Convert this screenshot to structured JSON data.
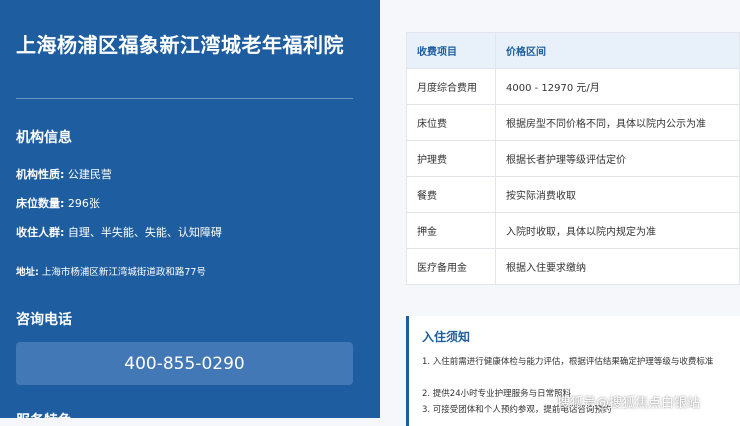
{
  "sidebar": {
    "title": "上海杨浦区福象新江湾城老年福利院",
    "info_heading": "机构信息",
    "nature_label": "机构性质:",
    "nature_value": "公建民营",
    "beds_label": "床位数量:",
    "beds_value": "296张",
    "residents_label": "收住人群:",
    "residents_value": "自理、半失能、失能、认知障碍",
    "address_label": "地址:",
    "address_value": "上海市杨浦区新江湾城街道政和路77号",
    "phone_heading": "咨询电话",
    "phone_number": "400-855-0290",
    "next_heading": "服务特色"
  },
  "fee_table": {
    "headers": [
      "收费项目",
      "价格区间"
    ],
    "rows": [
      [
        "月度综合费用",
        "4000 - 12970 元/月"
      ],
      [
        "床位费",
        "根据房型不同价格不同，具体以院内公示为准"
      ],
      [
        "护理费",
        "根据长者护理等级评估定价"
      ],
      [
        "餐费",
        "按实际消费收取"
      ],
      [
        "押金",
        "入院时收取，具体以院内规定为准"
      ],
      [
        "医疗备用金",
        "根据入住要求缴纳"
      ]
    ]
  },
  "notice": {
    "title": "入住须知",
    "items": [
      "1. 入住前需进行健康体检与能力评估，根据评估结果确定护理等级与收费标准",
      "2. 提供24小时专业护理服务与日常照料",
      "3. 可接受团体和个人预约参观，提前电话咨询预约"
    ]
  },
  "watermark": "搜狐号@搜狐焦点白银站",
  "colors": {
    "sidebar_bg": "#1d5da0",
    "phone_box_bg": "#4178b5",
    "table_header_bg": "#e8f0f9",
    "accent": "#1d5da0"
  }
}
